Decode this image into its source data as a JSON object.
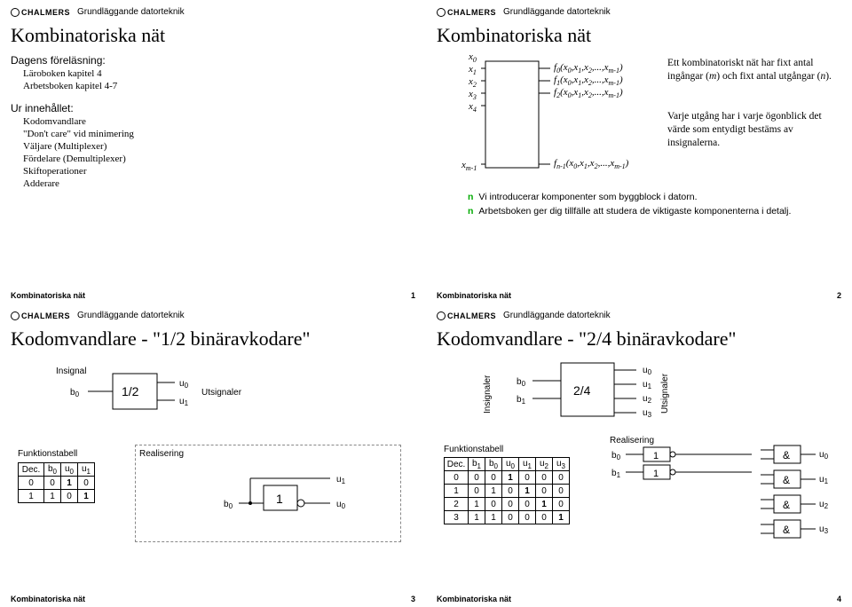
{
  "brand": "CHALMERS",
  "course": "Grundläggande datorteknik",
  "footerLabel": "Kombinatoriska nät",
  "slide1": {
    "title": "Kombinatoriska nät",
    "h1": "Dagens föreläsning:",
    "li1": "Läroboken kapitel 4",
    "li2": "Arbetsboken kapitel 4-7",
    "h2": "Ur innehållet:",
    "li3": "Kodomvandlare",
    "li4": "\"Don't care\" vid minimering",
    "li5": "Väljare (Multiplexer)",
    "li6": "Fördelare (Demultiplexer)",
    "li7": "Skiftoperationer",
    "li8": "Adderare",
    "page": "1"
  },
  "slide2": {
    "title": "Kombinatoriska nät",
    "x": [
      "x0",
      "x1",
      "x2",
      "x3",
      "x4",
      "xm-1"
    ],
    "f": [
      "f0(x0,x1,x2,...,xm-1)",
      "f1(x0,x1,x2,...,xm-1)",
      "f2(x0,x1,x2,...,xm-1)",
      "fn-1(x0,x1,x2,...,xm-1)"
    ],
    "para1": "Ett kombinatoriskt nät har fixt antal ingångar (m) och fixt antal utgångar (n).",
    "para2": "Varje utgång har i varje ögonblick det värde som entydigt bestäms av insignalerna.",
    "b1": "Vi introducerar komponenter som byggblock i datorn.",
    "b2": "Arbetsboken ger dig tillfälle att studera de viktigaste komponenterna i detalj.",
    "page": "2"
  },
  "slide3": {
    "title": "Kodomvandlare - \"1/2 binäravkodare\"",
    "insignal": "Insignal",
    "utsignaler": "Utsignaler",
    "b0": "b0",
    "blockLabel": "1/2",
    "u0": "u0",
    "u1": "u1",
    "ftLabel": "Funktionstabell",
    "realLabel": "Realisering",
    "ftHdr": [
      "Dec.",
      "b0",
      "u0",
      "u1"
    ],
    "ftRows": [
      [
        "0",
        "0",
        "1",
        "0"
      ],
      [
        "1",
        "1",
        "0",
        "1"
      ]
    ],
    "gate": "1",
    "page": "3"
  },
  "slide4": {
    "title": "Kodomvandlare - \"2/4 binäravkodare\"",
    "insignaler": "Insignaler",
    "utsignaler": "Utsignaler",
    "b0": "b0",
    "b1": "b1",
    "blockLabel": "2/4",
    "u": [
      "u0",
      "u1",
      "u2",
      "u3"
    ],
    "ftLabel": "Funktionstabell",
    "realLabel": "Realisering",
    "ftHdr": [
      "Dec.",
      "b1",
      "b0",
      "u0",
      "u1",
      "u2",
      "u3"
    ],
    "ftRows": [
      [
        "0",
        "0",
        "0",
        "1",
        "0",
        "0",
        "0"
      ],
      [
        "1",
        "0",
        "1",
        "0",
        "1",
        "0",
        "0"
      ],
      [
        "2",
        "1",
        "0",
        "0",
        "0",
        "1",
        "0"
      ],
      [
        "3",
        "1",
        "1",
        "0",
        "0",
        "0",
        "1"
      ]
    ],
    "gate": "1",
    "and": "&",
    "page": "4"
  }
}
